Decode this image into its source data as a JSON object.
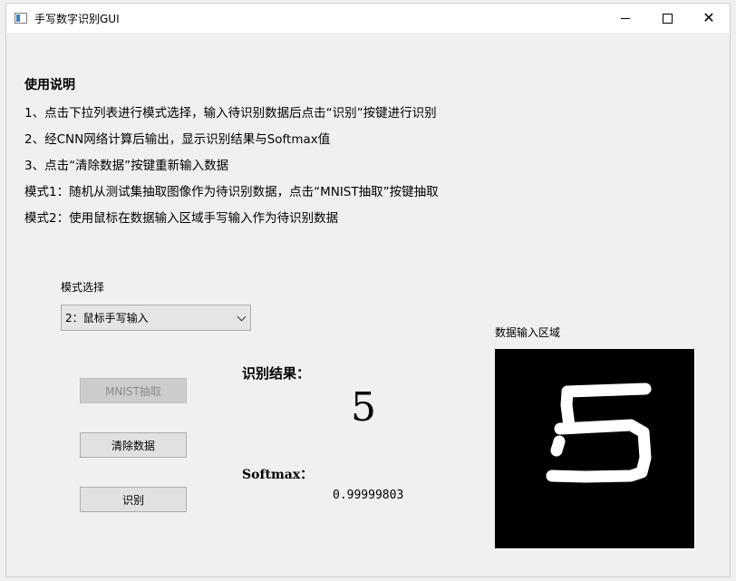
{
  "window": {
    "title": "手写数字识别GUI",
    "controls": {
      "minimize": "minimize",
      "maximize": "maximize",
      "close": "close"
    }
  },
  "instructions": {
    "title": "使用说明",
    "lines": [
      "1、点击下拉列表进行模式选择，输入待识别数据后点击“识别”按键进行识别",
      "2、经CNN网络计算后输出，显示识别结果与Softmax值",
      "3、点击“清除数据”按键重新输入数据",
      "模式1：随机从测试集抽取图像作为待识别数据，点击“MNIST抽取”按键抽取",
      "模式2：使用鼠标在数据输入区域手写输入作为待识别数据"
    ]
  },
  "mode": {
    "label": "模式选择",
    "selected": "2：鼠标手写输入"
  },
  "buttons": {
    "mnist": "MNIST抽取",
    "mnist_enabled": false,
    "clear": "清除数据",
    "recognize": "识别"
  },
  "result": {
    "label": "识别结果：",
    "digit": "5",
    "softmax_label": "Softmax：",
    "softmax_value": "0.99999803"
  },
  "canvas": {
    "label": "数据输入区域",
    "background": "#000000",
    "stroke_color": "#ffffff",
    "content": "handwritten digit 5"
  }
}
